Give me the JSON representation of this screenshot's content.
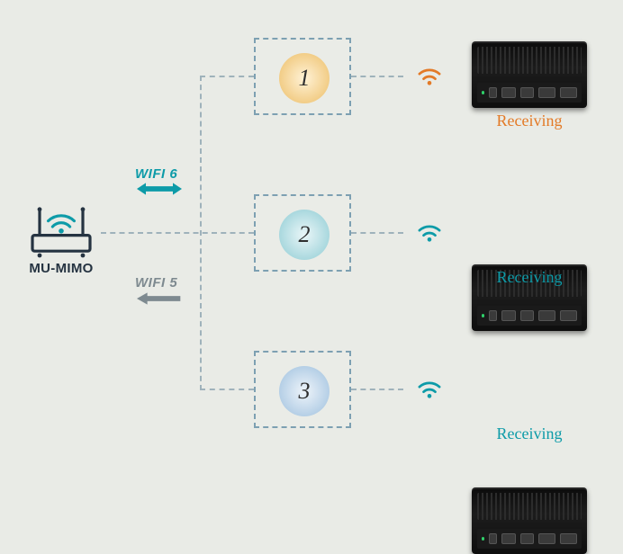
{
  "router": {
    "label": "MU-MIMO"
  },
  "wifi6": {
    "label": "WIFI 6"
  },
  "wifi5": {
    "label": "WIFI 5"
  },
  "nodes": [
    {
      "num": "1",
      "status": "Receiving",
      "color": "orange"
    },
    {
      "num": "2",
      "status": "Receiving",
      "color": "teal"
    },
    {
      "num": "3",
      "status": "Receiving",
      "color": "teal"
    }
  ]
}
